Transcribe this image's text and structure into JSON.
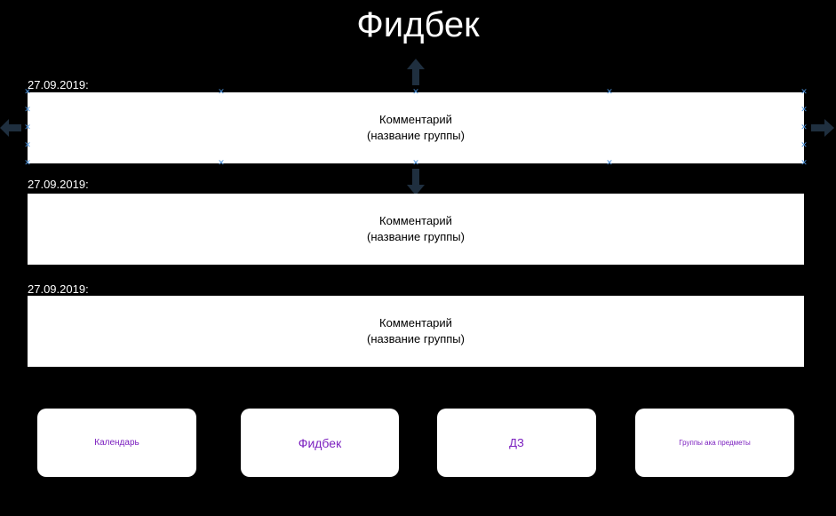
{
  "header": {
    "title": "Фидбек"
  },
  "feedback_list": [
    {
      "date": "27.09.2019:",
      "comment": "Комментарий",
      "group": "(название группы)"
    },
    {
      "date": "27.09.2019:",
      "comment": "Комментарий",
      "group": "(название группы)"
    },
    {
      "date": "27.09.2019:",
      "comment": "Комментарий",
      "group": "(название группы)"
    }
  ],
  "bottom_nav": [
    {
      "label": "Календарь"
    },
    {
      "label": "Фидбек"
    },
    {
      "label": "ДЗ"
    },
    {
      "label": "Группы ака предметы"
    }
  ],
  "colors": {
    "background": "#000000",
    "card": "#ffffff",
    "nav_text": "#7b1fbf",
    "selection_handle": "#4a90d9",
    "resize_arrow": "#1f2f3f"
  }
}
